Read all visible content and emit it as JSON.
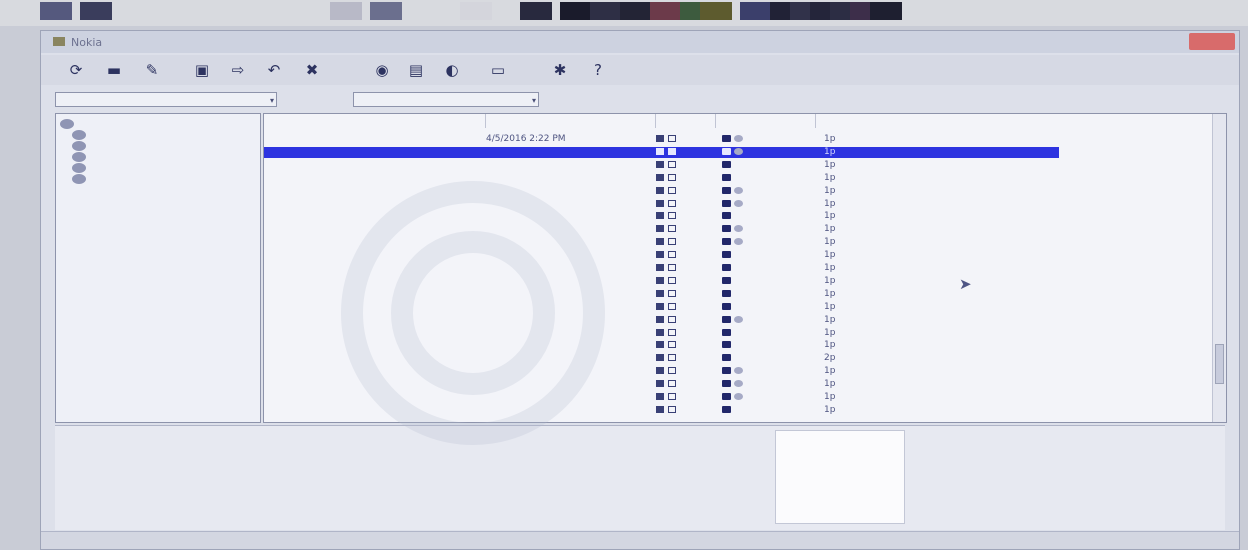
{
  "window": {
    "title": "Nokia",
    "title_icon": "window-app-icon"
  },
  "toolbar": {
    "buttons": [
      {
        "icon": "refresh-icon",
        "glyph": "⟳"
      },
      {
        "icon": "phone-icon",
        "glyph": "▬"
      },
      {
        "icon": "edit-icon",
        "glyph": "✎"
      },
      {
        "icon": "save-icon",
        "glyph": "▣"
      },
      {
        "icon": "forward-icon",
        "glyph": "⇨"
      },
      {
        "icon": "reply-icon",
        "glyph": "↶"
      },
      {
        "icon": "delete-icon",
        "glyph": "✖"
      },
      {
        "icon": "contacts-icon",
        "glyph": "◉"
      },
      {
        "icon": "message-icon",
        "glyph": "▤"
      },
      {
        "icon": "sync-icon",
        "glyph": "◐"
      },
      {
        "icon": "view-icon",
        "glyph": "▭"
      },
      {
        "icon": "tools-icon",
        "glyph": "✱"
      },
      {
        "icon": "help-icon",
        "glyph": "?"
      }
    ]
  },
  "filter": {
    "left_value": "",
    "right_label": "",
    "right_value": ""
  },
  "tree": {
    "items": [
      {
        "label": "",
        "icon": "phone-folder-icon"
      },
      {
        "label": "",
        "icon": "inbox-folder-icon"
      },
      {
        "label": "",
        "icon": "folder-icon"
      },
      {
        "label": "",
        "icon": "folder-icon"
      },
      {
        "label": "",
        "icon": "folder-icon"
      },
      {
        "label": "",
        "icon": "folder-icon"
      }
    ]
  },
  "list": {
    "columns": [
      "",
      "",
      "",
      "",
      ""
    ],
    "rows": [
      {
        "contact": "",
        "date": "4/5/2016 2:22 PM",
        "size": "1p",
        "status_icons": 2
      },
      {
        "contact": "",
        "date": "",
        "size": "1p",
        "status_icons": 2,
        "selected": true
      },
      {
        "contact": "",
        "date": "",
        "size": "1p",
        "status_icons": 1
      },
      {
        "contact": "",
        "date": "",
        "size": "1p",
        "status_icons": 1
      },
      {
        "contact": "",
        "date": "",
        "size": "1p",
        "status_icons": 2
      },
      {
        "contact": "",
        "date": "",
        "size": "1p",
        "status_icons": 2
      },
      {
        "contact": "",
        "date": "",
        "size": "1p",
        "status_icons": 1
      },
      {
        "contact": "",
        "date": "",
        "size": "1p",
        "status_icons": 2
      },
      {
        "contact": "",
        "date": "",
        "size": "1p",
        "status_icons": 2
      },
      {
        "contact": "",
        "date": "",
        "size": "1p",
        "status_icons": 1
      },
      {
        "contact": "",
        "date": "",
        "size": "1p",
        "status_icons": 1
      },
      {
        "contact": "",
        "date": "",
        "size": "1p",
        "status_icons": 1
      },
      {
        "contact": "",
        "date": "",
        "size": "1p",
        "status_icons": 1
      },
      {
        "contact": "",
        "date": "",
        "size": "1p",
        "status_icons": 1
      },
      {
        "contact": "",
        "date": "",
        "size": "1p",
        "status_icons": 2
      },
      {
        "contact": "",
        "date": "",
        "size": "1p",
        "status_icons": 1
      },
      {
        "contact": "",
        "date": "",
        "size": "1p",
        "status_icons": 1
      },
      {
        "contact": "",
        "date": "",
        "size": "2p",
        "status_icons": 1
      },
      {
        "contact": "",
        "date": "",
        "size": "1p",
        "status_icons": 2
      },
      {
        "contact": "",
        "date": "",
        "size": "1p",
        "status_icons": 2
      },
      {
        "contact": "",
        "date": "",
        "size": "1p",
        "status_icons": 2
      },
      {
        "contact": "",
        "date": "",
        "size": "1p",
        "status_icons": 1
      }
    ]
  },
  "details": {
    "left_lines": [
      "",
      "",
      "",
      "",
      "",
      "",
      ""
    ],
    "middle_lines": [
      "",
      "",
      "",
      "",
      "",
      ""
    ],
    "preview_lines": [
      "",
      "",
      "",
      "",
      "",
      "",
      ""
    ]
  },
  "status": {
    "left": "",
    "right": ""
  },
  "palette_colors": [
    "#55597e",
    "#3a3d5c",
    "#b8b9c7",
    "#6b6f8e",
    "#d4d5dc",
    "#28293e",
    "#1a1b2b",
    "#2e2f45",
    "#232435",
    "#6c3a4a",
    "#3d5b3e",
    "#5d5b2e",
    "#3b3f6b",
    "#212236",
    "#31324a",
    "#24253a",
    "#2c2d44",
    "#3d2e4a",
    "#1e1f30"
  ]
}
